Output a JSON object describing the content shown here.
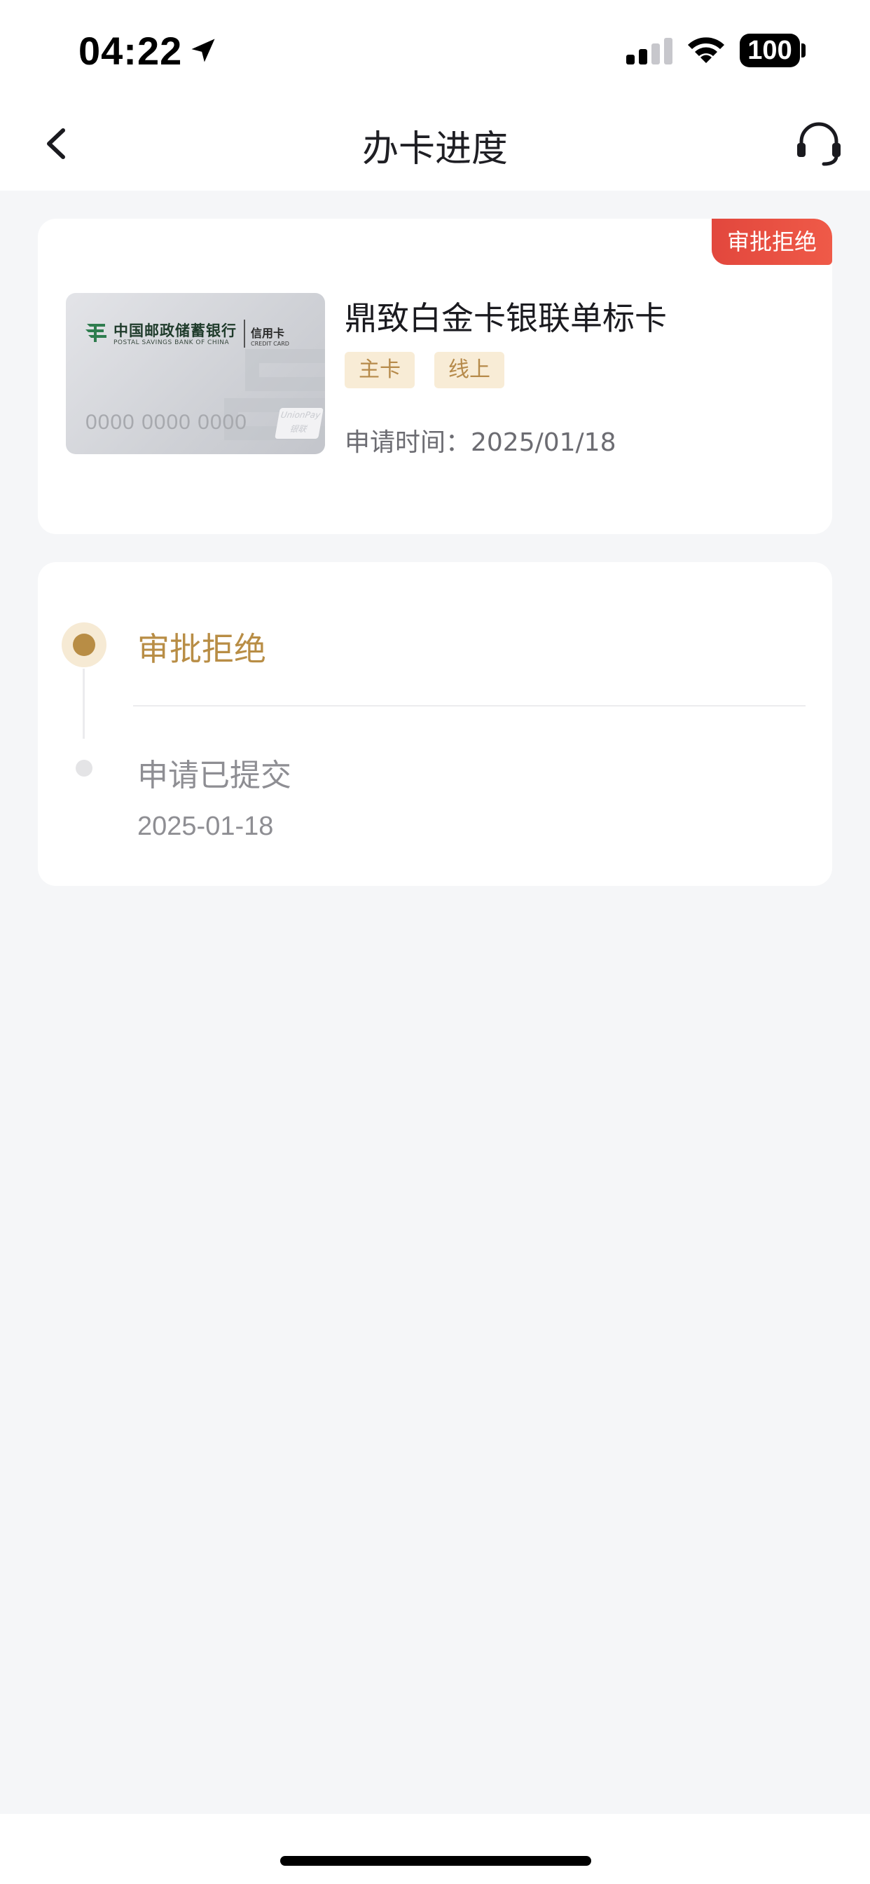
{
  "status_bar": {
    "time": "04:22",
    "battery": "100"
  },
  "nav": {
    "title": "办卡进度"
  },
  "card": {
    "status_badge": "审批拒绝",
    "name": "鼎致白金卡银联单标卡",
    "tags": [
      "主卡",
      "线上"
    ],
    "apply_time": "申请时间：2025/01/18",
    "image": {
      "bank_name": "中国邮政储蓄银行",
      "bank_name_en": "POSTAL SAVINGS BANK OF CHINA",
      "card_type": "信用卡",
      "card_type_en": "CREDIT CARD",
      "number": "0000 0000 0000",
      "network": "UnionPay 银联"
    }
  },
  "progress": {
    "steps": [
      {
        "title": "审批拒绝",
        "date": ""
      },
      {
        "title": "申请已提交",
        "date": "2025-01-18"
      }
    ]
  },
  "colors": {
    "accent_gold": "#b88d45",
    "badge_red": "#e2473d",
    "tag_bg": "#f8ecd6",
    "page_bg": "#f5f6f8"
  }
}
